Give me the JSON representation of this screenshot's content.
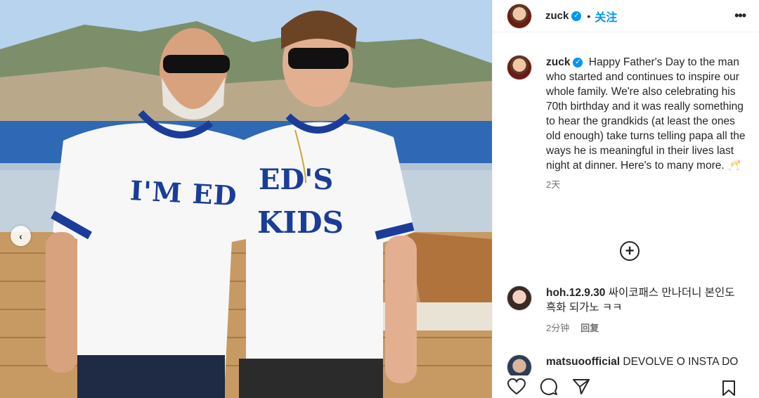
{
  "post": {
    "username": "zuck",
    "dot": "•",
    "follow_label": "关注",
    "more_label": "•••",
    "carousel_prev": "‹"
  },
  "caption": {
    "username": "zuck",
    "text": "Happy Father's Day to the man who started and continues to inspire our whole family. We're also celebrating his 70th birthday and it was really something to hear the grandkids (at least the ones old enough) take turns telling papa all the ways he is meaningful in their lives last night at dinner. Here's to many more. 🥂",
    "time": "2天"
  },
  "comments": [
    {
      "username": "hoh.12.9.30",
      "text": "싸이코패스 만나더니 본인도 흑화 되가노 ㅋㅋ",
      "time": "2分钟",
      "reply_label": "回复"
    },
    {
      "username": "matsuoofficial",
      "text": "DEVOLVE O INSTA DO"
    }
  ],
  "photo": {
    "shirt_left_text": "I'M ED",
    "shirt_right_line1": "ED'S",
    "shirt_right_line2": "KIDS"
  },
  "icons": [
    "verified-badge-icon",
    "more-icon",
    "add-comment-icon",
    "heart-icon",
    "comment-icon",
    "share-icon",
    "bookmark-icon",
    "chevron-left-icon"
  ],
  "colors": {
    "accent": "#0095f6",
    "text": "#262626",
    "muted": "#737373",
    "shirt_print": "#1b3d99"
  }
}
